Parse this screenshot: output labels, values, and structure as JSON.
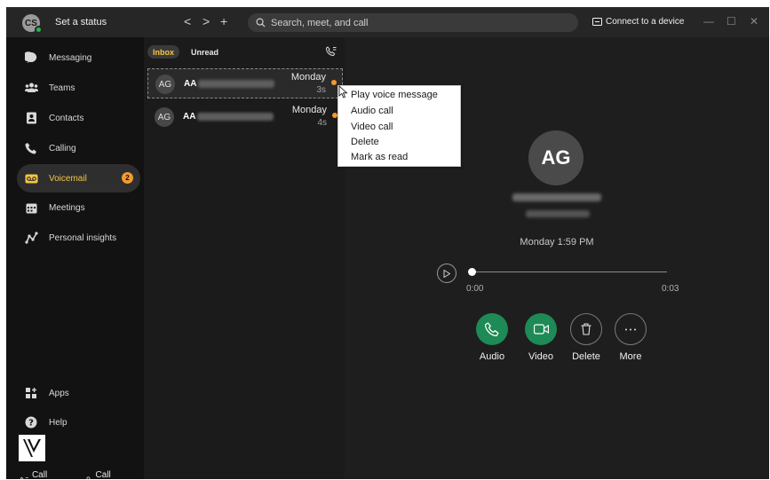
{
  "titlebar": {
    "user_initials": "CS",
    "status": "Set a status",
    "back": "<",
    "forward": ">",
    "new": "+",
    "search_placeholder": "Search, meet, and call",
    "connect_device": "Connect to a device",
    "minimize": "—",
    "maximize": "☐",
    "close": "✕"
  },
  "sidebar": {
    "items": [
      {
        "label": "Messaging",
        "icon": "chat-bubble-icon"
      },
      {
        "label": "Teams",
        "icon": "teams-icon"
      },
      {
        "label": "Contacts",
        "icon": "contacts-icon"
      },
      {
        "label": "Calling",
        "icon": "phone-icon"
      },
      {
        "label": "Voicemail",
        "icon": "voicemail-icon",
        "badge": "2",
        "active": true
      },
      {
        "label": "Meetings",
        "icon": "calendar-icon"
      },
      {
        "label": "Personal insights",
        "icon": "insights-icon"
      }
    ],
    "apps_label": "Apps",
    "help_label": "Help",
    "call_settings": "Call settings",
    "call_pickup": "Call pickup"
  },
  "list": {
    "tabs": [
      "Inbox",
      "Unread"
    ],
    "rows": [
      {
        "initials": "AG",
        "name": "AA",
        "date": "Monday",
        "duration": "3s",
        "unread": true
      },
      {
        "initials": "AG",
        "name": "AA",
        "date": "Monday",
        "duration": "4s",
        "unread": true
      }
    ]
  },
  "context_menu": {
    "items": [
      "Play voice message",
      "Audio call",
      "Video call",
      "Delete",
      "Mark as read"
    ]
  },
  "detail": {
    "initials": "AG",
    "time": "Monday 1:59 PM",
    "position": "0:00",
    "duration": "0:03",
    "actions": [
      "Audio",
      "Video",
      "Delete",
      "More"
    ]
  },
  "colors": {
    "accent": "#f6c543",
    "badge": "#f29a2e",
    "call_green": "#1e8a55"
  }
}
